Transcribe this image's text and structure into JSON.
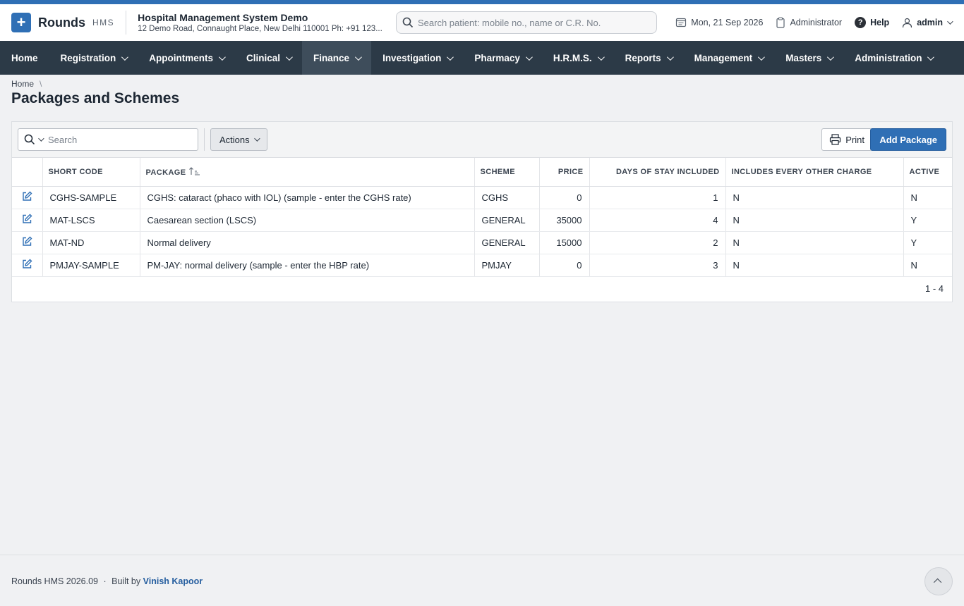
{
  "brand": {
    "name": "Rounds",
    "sub": "HMS"
  },
  "org": {
    "name": "Hospital Management System Demo",
    "address": "12 Demo Road, Connaught Place, New Delhi 110001 Ph: +91 123..."
  },
  "global_search": {
    "placeholder": "Search patient: mobile no., name or C.R. No."
  },
  "header": {
    "date": "Mon, 21 Sep 2026",
    "role": "Administrator",
    "help": "Help",
    "user": "admin"
  },
  "nav": {
    "items": [
      {
        "label": "Home"
      },
      {
        "label": "Registration"
      },
      {
        "label": "Appointments"
      },
      {
        "label": "Clinical"
      },
      {
        "label": "Finance",
        "active": true
      },
      {
        "label": "Investigation"
      },
      {
        "label": "Pharmacy"
      },
      {
        "label": "H.R.M.S."
      },
      {
        "label": "Reports"
      },
      {
        "label": "Management"
      },
      {
        "label": "Masters"
      },
      {
        "label": "Administration"
      }
    ]
  },
  "breadcrumb": {
    "home": "Home",
    "sep": "\\"
  },
  "page": {
    "title": "Packages and Schemes"
  },
  "toolbar": {
    "search_placeholder": "Search",
    "actions_label": "Actions",
    "print_label": "Print",
    "add_label": "Add Package"
  },
  "table": {
    "columns": [
      "SHORT CODE",
      "PACKAGE",
      "SCHEME",
      "PRICE",
      "DAYS OF STAY INCLUDED",
      "INCLUDES EVERY OTHER CHARGE",
      "ACTIVE"
    ],
    "rows": [
      [
        "CGHS-SAMPLE",
        "CGHS: cataract (phaco with IOL) (sample - enter the CGHS rate)",
        "CGHS",
        "0",
        "1",
        "N",
        "N"
      ],
      [
        "MAT-LSCS",
        "Caesarean section (LSCS)",
        "GENERAL",
        "35000",
        "4",
        "N",
        "Y"
      ],
      [
        "MAT-ND",
        "Normal delivery",
        "GENERAL",
        "15000",
        "2",
        "N",
        "Y"
      ],
      [
        "PMJAY-SAMPLE",
        "PM-JAY: normal delivery (sample - enter the HBP rate)",
        "PMJAY",
        "0",
        "3",
        "N",
        "N"
      ]
    ],
    "pagination": "1 - 4"
  },
  "footer": {
    "version": "Rounds HMS 2026.09",
    "built_by": "Built by",
    "author": "Vinish Kapoor",
    "dot": "·"
  },
  "colors": {
    "brand": "#2f6fb5",
    "nav_bg": "#2c3a47",
    "nav_active": "#3e4d5b"
  }
}
